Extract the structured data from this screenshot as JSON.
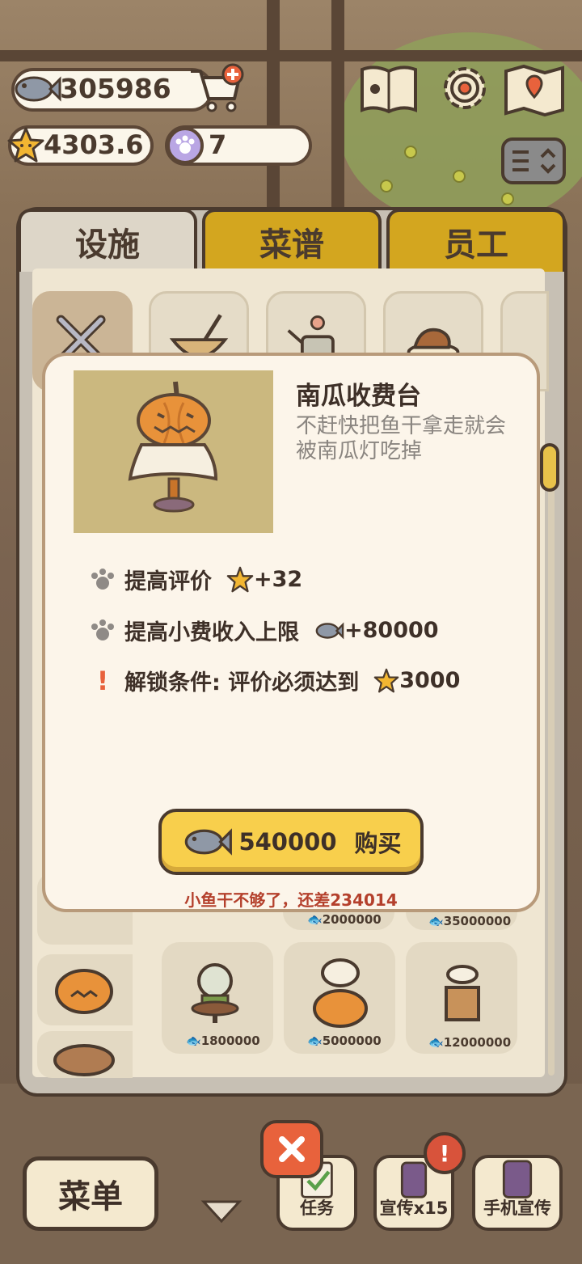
{
  "hud": {
    "fish_amount": "305986",
    "rating": "4303.6",
    "paw_tokens": "7"
  },
  "tabs": [
    {
      "label": "设施"
    },
    {
      "label": "菜谱"
    },
    {
      "label": "员工"
    }
  ],
  "popup": {
    "title": "南瓜收费台",
    "description": "不赶快把鱼干拿走就会被南瓜灯吃掉",
    "stats": [
      {
        "label": "提高评价",
        "value": "+32",
        "icon": "star-icon"
      },
      {
        "label": "提高小费收入上限",
        "value": "+80000",
        "icon": "fish-icon"
      }
    ],
    "unlock": {
      "label": "解锁条件: 评价必须达到",
      "value": "3000",
      "icon": "star-icon"
    },
    "buy": {
      "price": "540000",
      "label": "购买"
    },
    "warning": "小鱼干不够了，还差234014"
  },
  "shop_items": [
    {
      "price": "2000000"
    },
    {
      "price": "35000000"
    },
    {
      "price": "1800000"
    },
    {
      "price": "5000000"
    },
    {
      "price": "12000000"
    }
  ],
  "bottom_bar": {
    "menu": "菜单",
    "tasks": "任务",
    "promote": "宣传x15",
    "phone_promote": "手机宣传"
  },
  "colors": {
    "accent_yellow": "#f8cf4c",
    "outline_brown": "#4a3a2e",
    "warning_red": "#b4402c",
    "close_orange": "#e8623c"
  }
}
